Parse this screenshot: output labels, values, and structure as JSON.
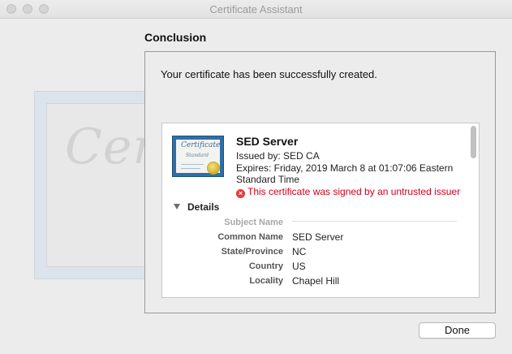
{
  "window": {
    "title": "Certificate Assistant"
  },
  "background_art": {
    "script_text": "Certif"
  },
  "page": {
    "heading": "Conclusion",
    "message": "Your certificate has been successfully created."
  },
  "certificate": {
    "thumbnail_title": "Certificate",
    "thumbnail_subtitle": "Standard",
    "name": "SED Server",
    "issued_by": "Issued by: SED CA",
    "expires_line1": "Expires: Friday, 2019 March 8 at 01:07:06 Eastern",
    "expires_line2": "Standard Time",
    "warning": "This certificate was signed by an untrusted issuer",
    "warning_icon": "error-x-icon",
    "warning_color": "#d0021b",
    "accent_color": "#2f6fa8"
  },
  "details": {
    "toggle_label": "Details",
    "section_label": "Subject Name",
    "rows": [
      {
        "label": "Common Name",
        "value": "SED Server"
      },
      {
        "label": "State/Province",
        "value": "NC"
      },
      {
        "label": "Country",
        "value": "US"
      },
      {
        "label": "Locality",
        "value": "Chapel Hill"
      }
    ]
  },
  "buttons": {
    "done": "Done"
  }
}
